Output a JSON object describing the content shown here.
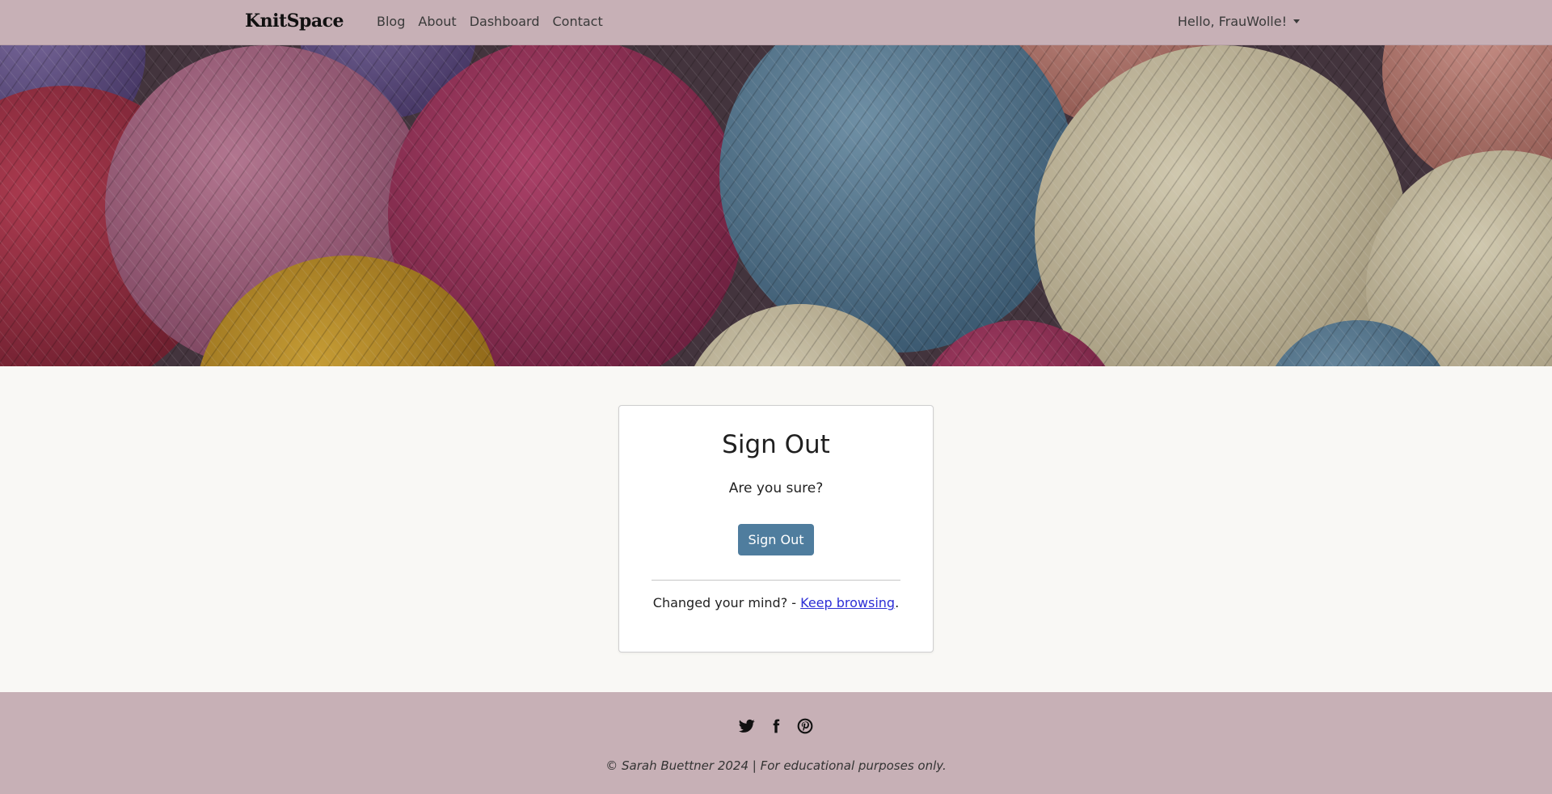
{
  "navbar": {
    "brand": "KnitSpace",
    "links": [
      "Blog",
      "About",
      "Dashboard",
      "Contact"
    ],
    "user_greeting": "Hello, FrauWolle!"
  },
  "hero": {
    "image_description": ""
  },
  "card": {
    "title": "Sign Out",
    "question": "Are you sure?",
    "button_label": "Sign Out",
    "changed_prefix": "Changed your mind? - ",
    "keep_browsing_link": "Keep browsing",
    "changed_suffix": "."
  },
  "footer": {
    "social_icons": [
      "twitter-icon",
      "facebook-icon",
      "pinterest-icon"
    ],
    "copyright": "© Sarah Buettner 2024 | For educational purposes only."
  },
  "colors": {
    "navbar_bg": "#c7b0b6",
    "page_bg": "#f9f8f5",
    "button_bg": "#4f7d9e",
    "link": "#2c2ed6"
  }
}
